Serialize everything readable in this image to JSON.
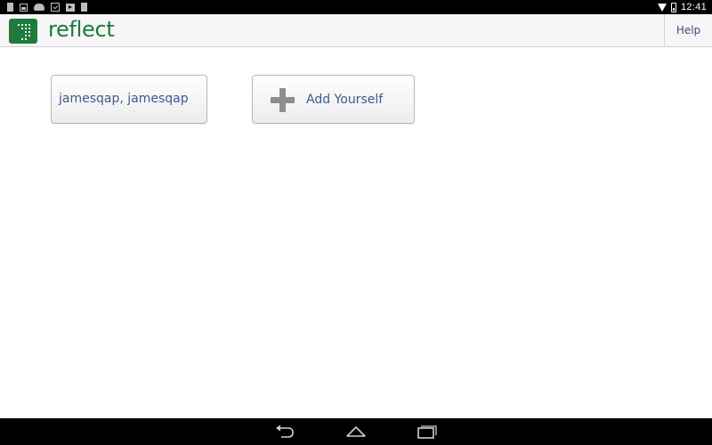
{
  "status_bar": {
    "time": "12:41",
    "left_icons": [
      "sd-card-icon",
      "image-icon",
      "cloud-upload-icon",
      "calendar-check-icon",
      "play-store-icon",
      "sd-card-icon"
    ],
    "right_icons": [
      "wifi-icon",
      "battery-icon"
    ]
  },
  "action_bar": {
    "app_name": "reflect",
    "help_label": "Help",
    "brand_color": "#1a7a3c"
  },
  "profiles": {
    "user_label": "jamesqap, jamesqap",
    "add_label": "Add Yourself"
  },
  "nav_bar": {
    "buttons": [
      "back-icon",
      "home-icon",
      "recent-apps-icon"
    ]
  }
}
